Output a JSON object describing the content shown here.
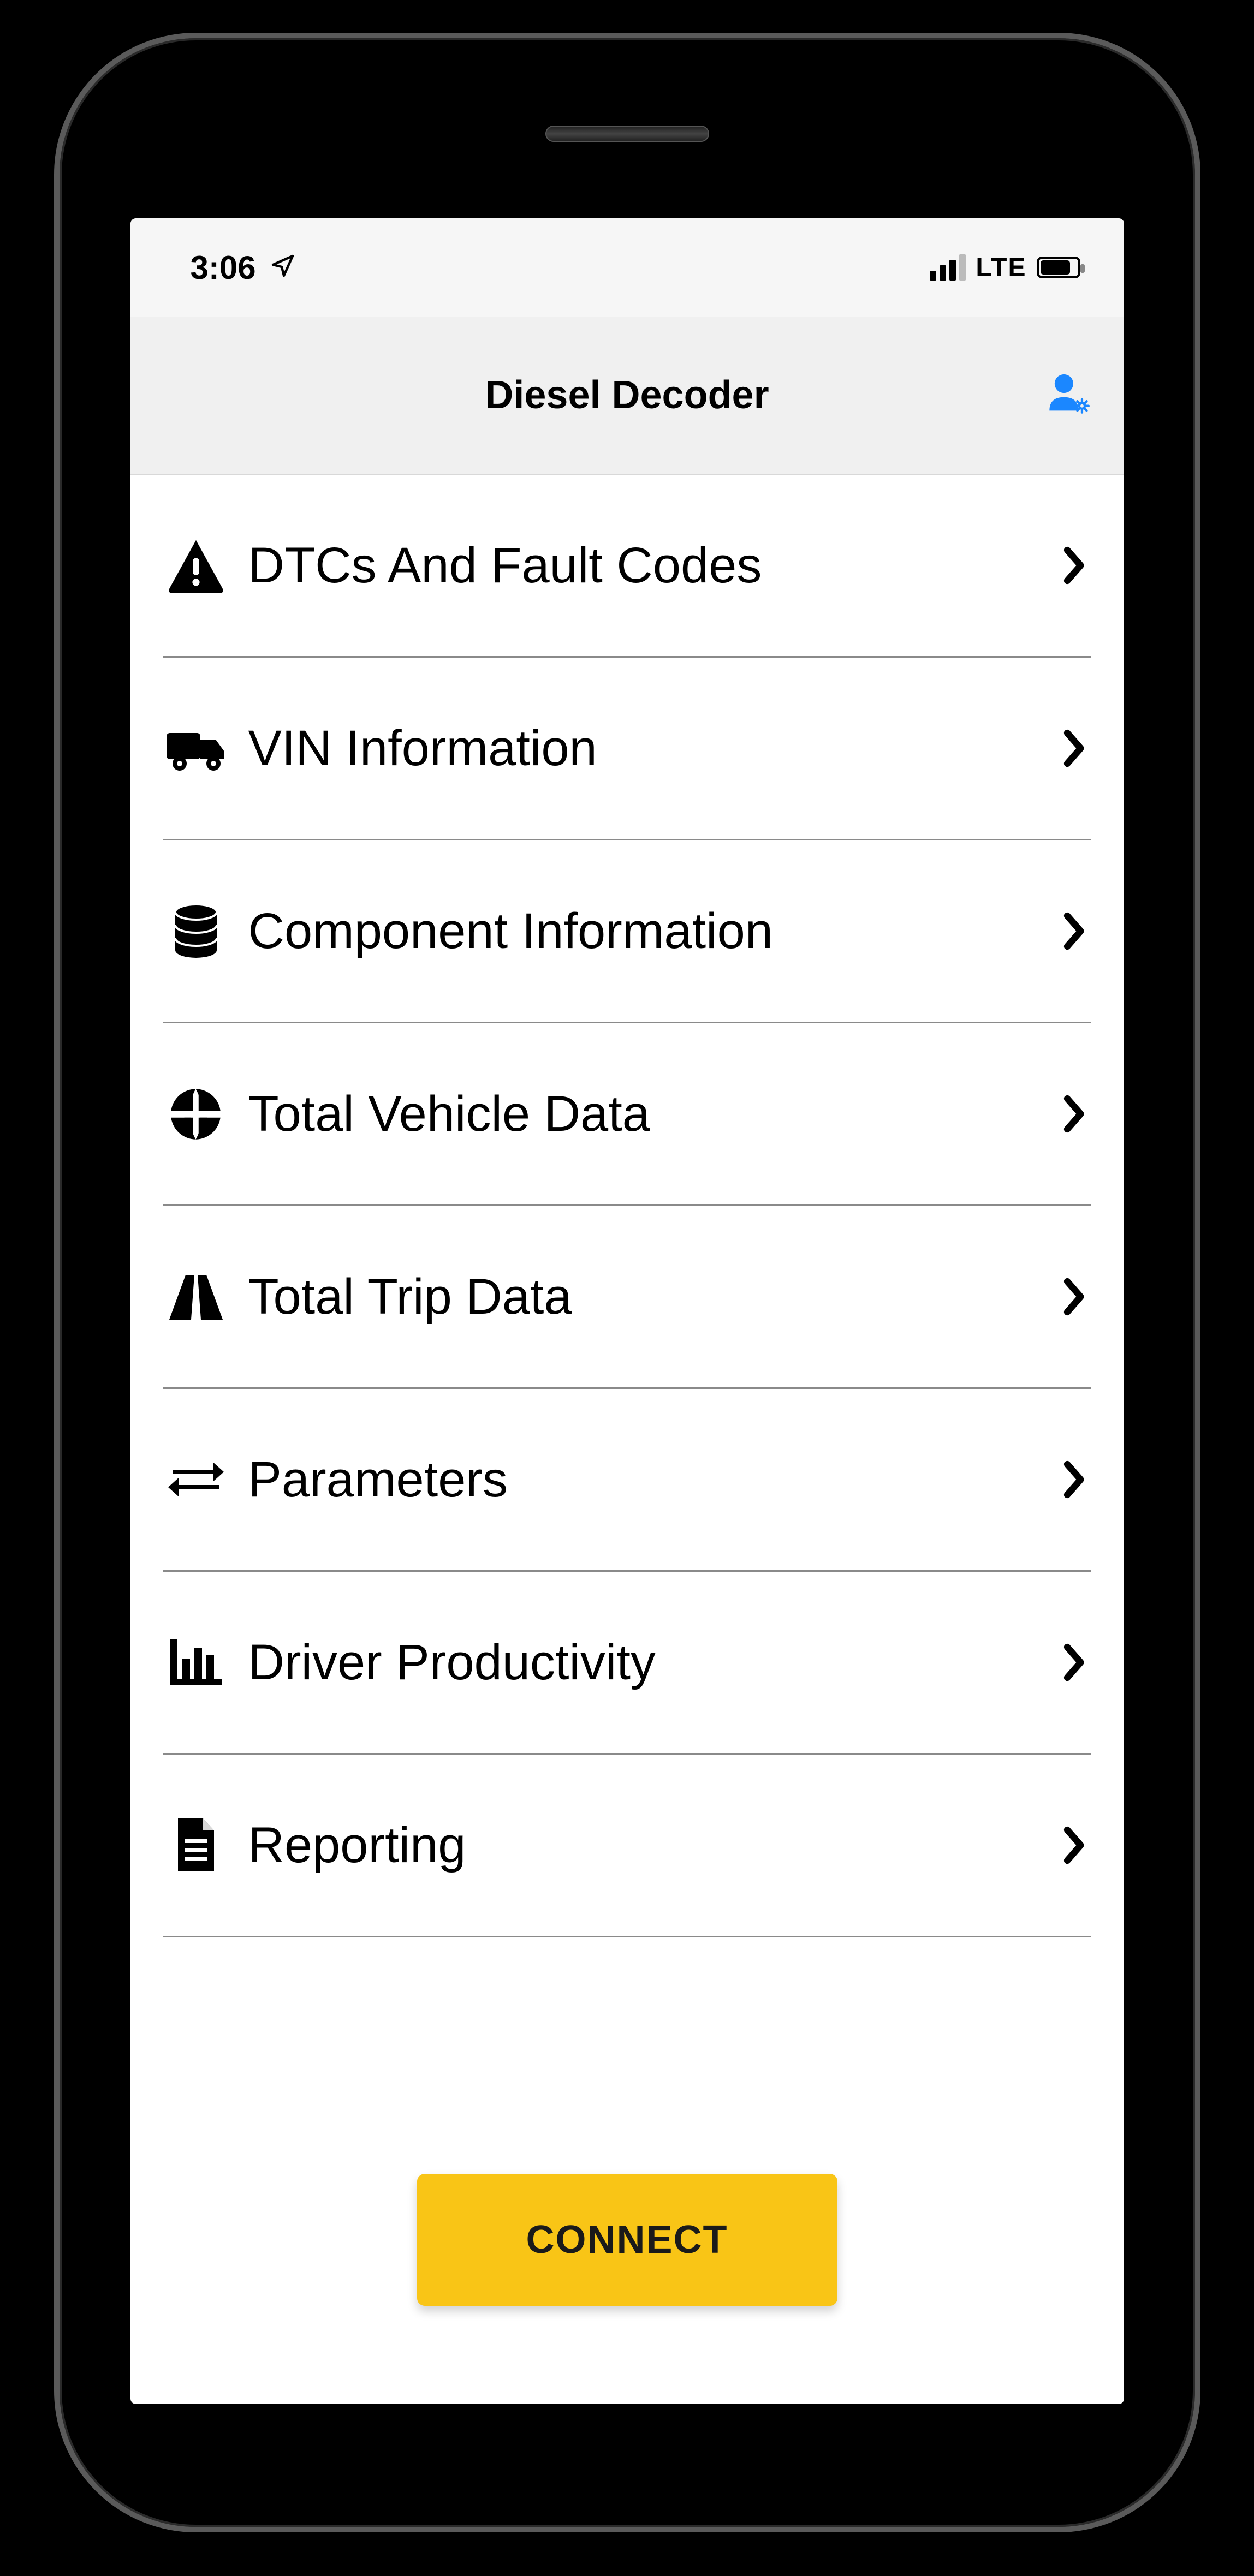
{
  "status": {
    "time": "3:06",
    "network_label": "LTE"
  },
  "header": {
    "title": "Diesel Decoder"
  },
  "menu": {
    "items": [
      {
        "icon": "warning-triangle-icon",
        "label": "DTCs And Fault Codes"
      },
      {
        "icon": "truck-icon",
        "label": "VIN Information"
      },
      {
        "icon": "database-icon",
        "label": "Component Information"
      },
      {
        "icon": "globe-icon",
        "label": "Total Vehicle Data"
      },
      {
        "icon": "road-icon",
        "label": "Total Trip Data"
      },
      {
        "icon": "arrows-exchange-icon",
        "label": "Parameters"
      },
      {
        "icon": "bar-chart-icon",
        "label": "Driver Productivity"
      },
      {
        "icon": "document-icon",
        "label": "Reporting"
      }
    ]
  },
  "actions": {
    "connect_label": "CONNECT"
  }
}
